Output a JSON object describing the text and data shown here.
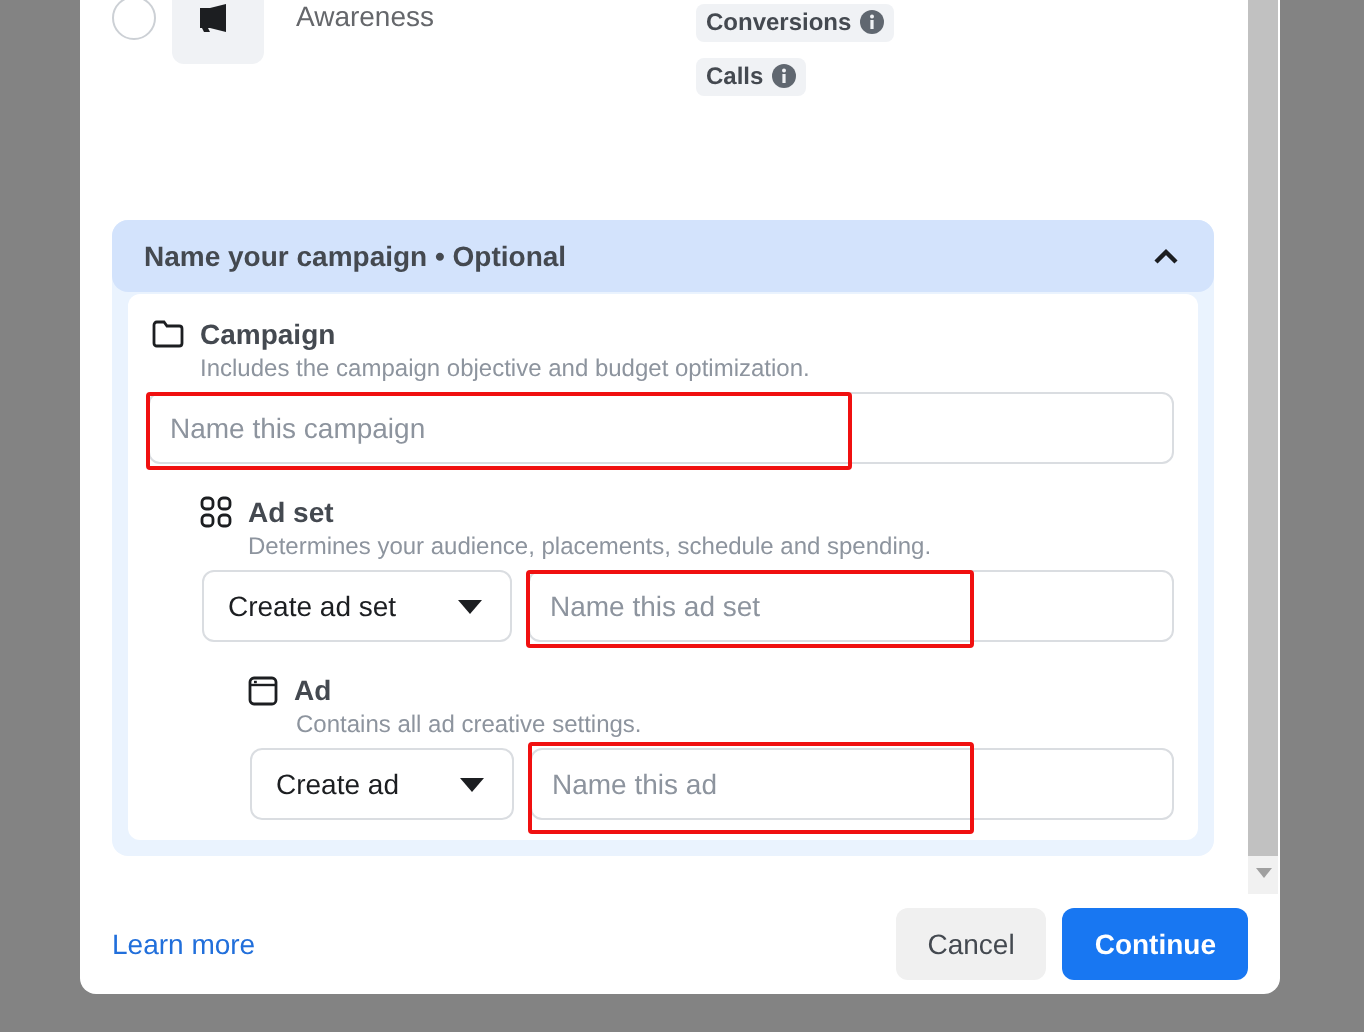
{
  "objective": {
    "selected": false,
    "label": "Awareness",
    "tags": [
      {
        "label": "Conversions"
      },
      {
        "label": "Calls"
      }
    ]
  },
  "naming": {
    "title": "Name your campaign • Optional",
    "expanded": true,
    "sections": [
      {
        "kind": "campaign",
        "title": "Campaign",
        "description": "Includes the campaign objective and budget optimization.",
        "placeholder": "Name this campaign",
        "highlighted": true
      },
      {
        "kind": "adset",
        "title": "Ad set",
        "description": "Determines your audience, placements, schedule and spending.",
        "select": "Create ad set",
        "placeholder": "Name this ad set",
        "highlighted": true
      },
      {
        "kind": "ad",
        "title": "Ad",
        "description": "Contains all ad creative settings.",
        "select": "Create ad",
        "placeholder": "Name this ad",
        "highlighted": true
      }
    ]
  },
  "footer": {
    "link": "Learn more",
    "buttons": [
      {
        "label": "Cancel",
        "kind": "secondary"
      },
      {
        "label": "Continue",
        "kind": "primary"
      }
    ]
  }
}
